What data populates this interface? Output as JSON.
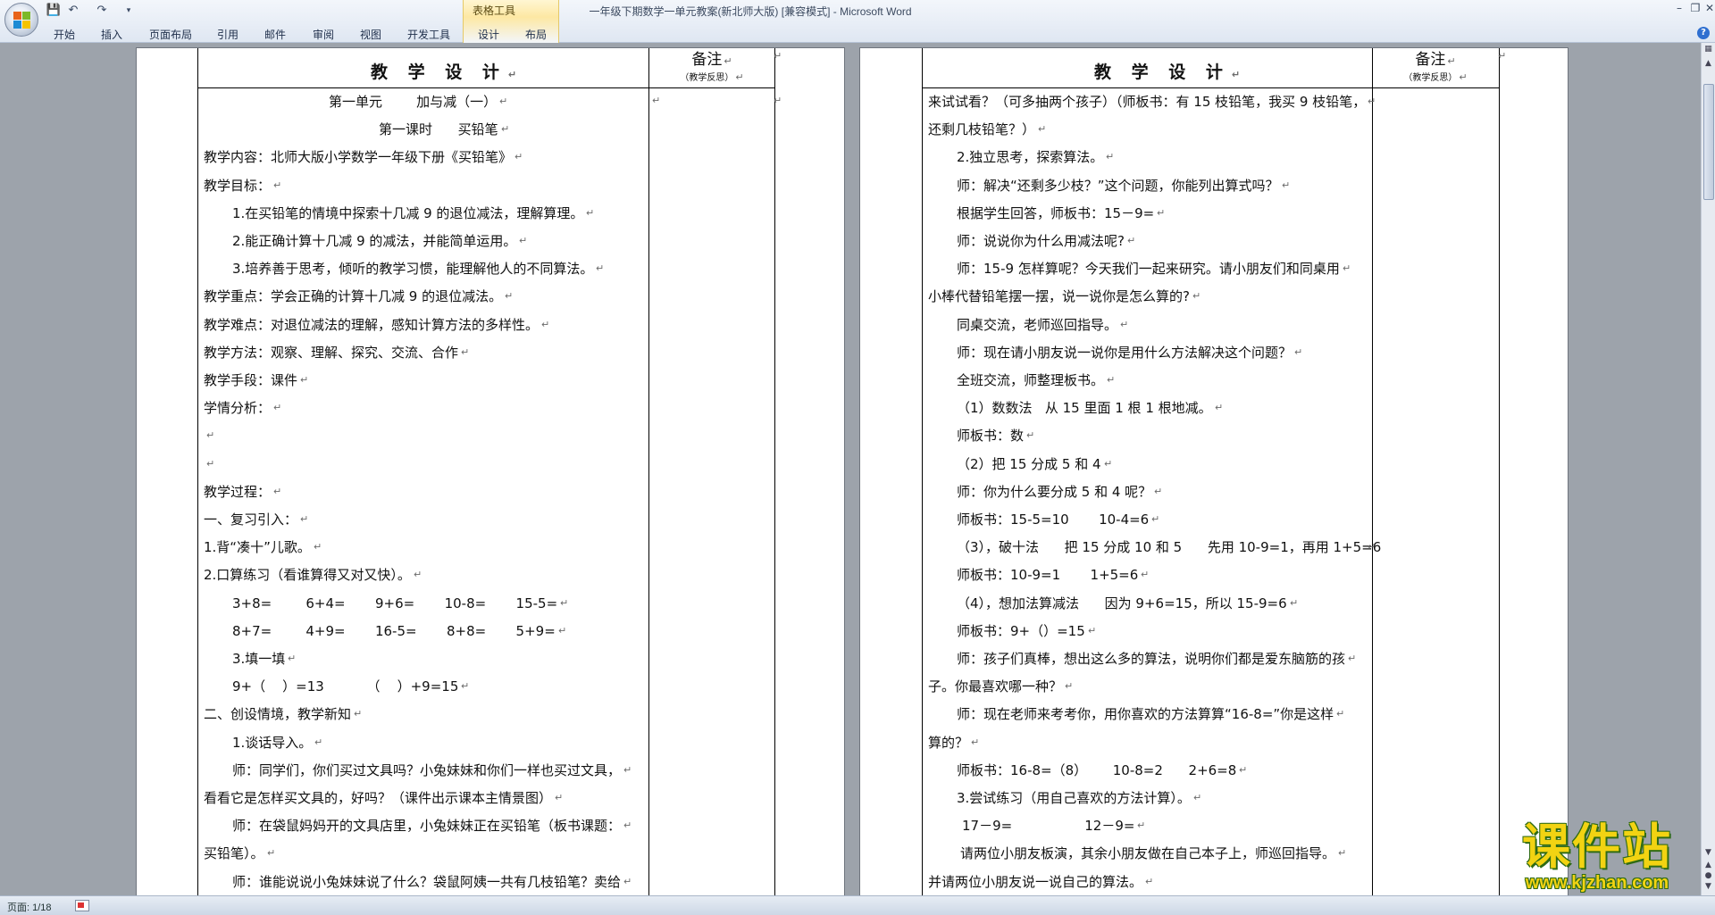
{
  "window": {
    "title": "一年级下期数学一单元教案(新北师大版) [兼容模式] - Microsoft Word",
    "contextual_group": "表格工具",
    "tabs": [
      "开始",
      "插入",
      "页面布局",
      "引用",
      "邮件",
      "审阅",
      "视图",
      "开发工具",
      "设计",
      "布局"
    ],
    "quick_access": [
      "save-icon",
      "undo-icon",
      "redo-icon",
      "customize-icon"
    ],
    "controls": [
      "minimize-icon",
      "restore-icon",
      "close-icon"
    ]
  },
  "page1": {
    "header_title": "教 学 设 计",
    "note_title": "备注",
    "note_sub": "（教学反思）",
    "lines": [
      {
        "t": "第一单元        加与减（一）",
        "indent": 1
      },
      {
        "t": "第一课时      买铅笔",
        "indent": 2
      },
      {
        "t": "教学内容：北师大版小学数学一年级下册《买铅笔》",
        "indent": 0
      },
      {
        "t": "教学目标：",
        "indent": 0
      },
      {
        "t": "1.在买铅笔的情境中探索十几减 9 的退位减法，理解算理。",
        "indent": 3
      },
      {
        "t": "2.能正确计算十几减 9 的减法，并能简单运用。",
        "indent": 3
      },
      {
        "t": "3.培养善于思考，倾听的教学习惯，能理解他人的不同算法。",
        "indent": 3
      },
      {
        "t": "教学重点：学会正确的计算十几减 9 的退位减法。",
        "indent": 0
      },
      {
        "t": "教学难点：对退位减法的理解，感知计算方法的多样性。",
        "indent": 0
      },
      {
        "t": "教学方法：观察、理解、探究、交流、合作",
        "indent": 0
      },
      {
        "t": "教学手段：课件",
        "indent": 0
      },
      {
        "t": "学情分析：",
        "indent": 0
      },
      {
        "t": "",
        "indent": 0
      },
      {
        "t": "",
        "indent": 0
      },
      {
        "t": "教学过程：",
        "indent": 0
      },
      {
        "t": "一、复习引入：",
        "indent": 0
      },
      {
        "t": "1.背“凑十”儿歌。",
        "indent": 0
      },
      {
        "t": "2.口算练习（看谁算得又对又快）。",
        "indent": 0
      },
      {
        "t": "3+8=        6+4=       9+6=       10-8=       15-5=",
        "indent": 3
      },
      {
        "t": "8+7=        4+9=       16-5=       8+8=       5+9=",
        "indent": 3
      },
      {
        "t": "3.填一填",
        "indent": 3
      },
      {
        "t": "9+（    ）=13          （    ）+9=15",
        "indent": 3
      },
      {
        "t": "二、创设情境，教学新知",
        "indent": 0
      },
      {
        "t": "1.谈话导入。",
        "indent": 3
      },
      {
        "t": "师：同学们，你们买过文具吗？小兔妹妹和你们一样也买过文具，",
        "indent": 3
      },
      {
        "t": "看看它是怎样买文具的，好吗？（课件出示课本主情景图）",
        "indent": 0
      },
      {
        "t": "师：在袋鼠妈妈开的文具店里，小兔妹妹正在买铅笔（板书课题：",
        "indent": 3
      },
      {
        "t": "买铅笔）。",
        "indent": 0
      },
      {
        "t": "师：谁能说说小兔妹妹说了什么？袋鼠阿姨一共有几枝铅笔？卖给",
        "indent": 3
      }
    ]
  },
  "page2": {
    "header_title": "教 学 设 计",
    "note_title": "备注",
    "note_sub": "（教学反思）",
    "lines": [
      {
        "t": "来试试看？（可多抽两个孩子）（师板书：有 15 枝铅笔，我买 9 枝铅笔，",
        "indent": 0
      },
      {
        "t": "还剩几枝铅笔？）",
        "indent": 0
      },
      {
        "t": "2.独立思考，探索算法。",
        "indent": 3
      },
      {
        "t": "师：解决“还剩多少枝？”这个问题，你能列出算式吗？",
        "indent": 3
      },
      {
        "t": "根据学生回答，师板书：15－9=",
        "indent": 3
      },
      {
        "t": "师：说说你为什么用减法呢?",
        "indent": 3
      },
      {
        "t": "师：15-9 怎样算呢？今天我们一起来研究。请小朋友们和同桌用",
        "indent": 3
      },
      {
        "t": "小棒代替铅笔摆一摆，说一说你是怎么算的?",
        "indent": 0
      },
      {
        "t": "同桌交流，老师巡回指导。",
        "indent": 3
      },
      {
        "t": "师：现在请小朋友说一说你是用什么方法解决这个问题？",
        "indent": 3
      },
      {
        "t": "全班交流，师整理板书。",
        "indent": 3
      },
      {
        "t": "（1）数数法   从 15 里面 1 根 1 根地减。",
        "indent": 3
      },
      {
        "t": "师板书：数",
        "indent": 3
      },
      {
        "t": "（2）把 15 分成 5 和 4",
        "indent": 3
      },
      {
        "t": "师：你为什么要分成 5 和 4 呢？",
        "indent": 3
      },
      {
        "t": "师板书：15-5=10       10-4=6",
        "indent": 3
      },
      {
        "t": "（3），破十法      把 15 分成 10 和 5      先用 10-9=1，再用 1+5=6",
        "indent": 3
      },
      {
        "t": "师板书：10-9=1       1+5=6",
        "indent": 3
      },
      {
        "t": "（4），想加法算减法      因为 9+6=15，所以 15-9=6",
        "indent": 3
      },
      {
        "t": "师板书：9+（）=15",
        "indent": 3
      },
      {
        "t": "师：孩子们真棒，想出这么多的算法，说明你们都是爱东脑筋的孩",
        "indent": 3
      },
      {
        "t": "子。你最喜欢哪一种？",
        "indent": 0
      },
      {
        "t": "师：现在老师来考考你，用你喜欢的方法算算“16-8=”你是这样",
        "indent": 3
      },
      {
        "t": "算的？",
        "indent": 0
      },
      {
        "t": "师板书：16-8=（8）      10-8=2      2+6=8",
        "indent": 3
      },
      {
        "t": "3.尝试练习（用自己喜欢的方法计算）。",
        "indent": 3
      },
      {
        "t": "17－9=                 12－9=",
        "indent": 5
      },
      {
        "t": "请两位小朋友板演，其余小朋友做在自己本子上，师巡回指导。",
        "indent": 4
      },
      {
        "t": "并请两位小朋友说一说自己的算法。",
        "indent": 0
      }
    ]
  },
  "status": {
    "page": "页面: 1/18"
  },
  "watermark": {
    "main": "课件站",
    "url": "www.kjzhan.com"
  },
  "colors": {
    "ribbon_bg": "#dfe7f2",
    "workspace_bg": "#9da3ab",
    "table_tools_accent": "#fde8a3",
    "watermark_fill": "#f2d312",
    "watermark_outline": "#2f6b14"
  }
}
